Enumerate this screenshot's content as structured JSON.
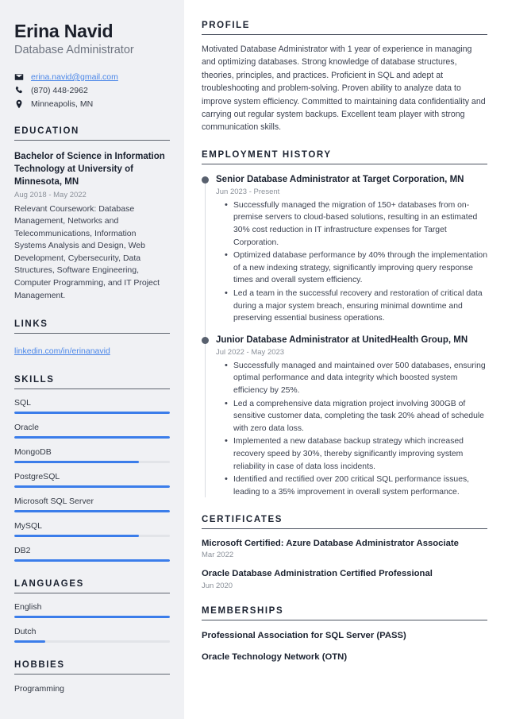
{
  "header": {
    "name": "Erina Navid",
    "job_title": "Database Administrator",
    "contacts": [
      {
        "icon": "envelope-icon",
        "value": "erina.navid@gmail.com",
        "is_link": true
      },
      {
        "icon": "phone-icon",
        "value": "(870) 448-2962",
        "is_link": false
      },
      {
        "icon": "location-pin-icon",
        "value": "Minneapolis, MN",
        "is_link": false
      }
    ]
  },
  "sidebar": {
    "education": {
      "heading": "EDUCATION",
      "degree": "Bachelor of Science in Information Technology at University of Minnesota, MN",
      "date": "Aug 2018 - May 2022",
      "description": "Relevant Coursework: Database Management, Networks and Telecommunications, Information Systems Analysis and Design, Web Development, Cybersecurity, Data Structures, Software Engineering, Computer Programming, and IT Project Management."
    },
    "links": {
      "heading": "LINKS",
      "items": [
        {
          "label": "linkedin.com/in/erinanavid"
        }
      ]
    },
    "skills": {
      "heading": "SKILLS",
      "items": [
        {
          "label": "SQL",
          "level": 100
        },
        {
          "label": "Oracle",
          "level": 100
        },
        {
          "label": "MongoDB",
          "level": 80
        },
        {
          "label": "PostgreSQL",
          "level": 100
        },
        {
          "label": "Microsoft SQL Server",
          "level": 100
        },
        {
          "label": "MySQL",
          "level": 80
        },
        {
          "label": "DB2",
          "level": 100
        }
      ]
    },
    "languages": {
      "heading": "LANGUAGES",
      "items": [
        {
          "label": "English",
          "level": 100
        },
        {
          "label": "Dutch",
          "level": 20
        }
      ]
    },
    "hobbies": {
      "heading": "HOBBIES",
      "items": [
        {
          "label": "Programming"
        }
      ]
    }
  },
  "main": {
    "profile": {
      "heading": "PROFILE",
      "text": "Motivated Database Administrator with 1 year of experience in managing and optimizing databases. Strong knowledge of database structures, theories, principles, and practices. Proficient in SQL and adept at troubleshooting and problem-solving. Proven ability to analyze data to improve system efficiency. Committed to maintaining data confidentiality and carrying out regular system backups. Excellent team player with strong communication skills."
    },
    "employment": {
      "heading": "EMPLOYMENT HISTORY",
      "jobs": [
        {
          "role": "Senior Database Administrator at Target Corporation, MN",
          "date": "Jun 2023 - Present",
          "bullets": [
            "Successfully managed the migration of 150+ databases from on-premise servers to cloud-based solutions, resulting in an estimated 30% cost reduction in IT infrastructure expenses for Target Corporation.",
            "Optimized database performance by 40% through the implementation of a new indexing strategy, significantly improving query response times and overall system efficiency.",
            "Led a team in the successful recovery and restoration of critical data during a major system breach, ensuring minimal downtime and preserving essential business operations."
          ]
        },
        {
          "role": "Junior Database Administrator at UnitedHealth Group, MN",
          "date": "Jul 2022 - May 2023",
          "bullets": [
            "Successfully managed and maintained over 500 databases, ensuring optimal performance and data integrity which boosted system efficiency by 25%.",
            "Led a comprehensive data migration project involving 300GB of sensitive customer data, completing the task 20% ahead of schedule with zero data loss.",
            "Implemented a new database backup strategy which increased recovery speed by 30%, thereby significantly improving system reliability in case of data loss incidents.",
            "Identified and rectified over 200 critical SQL performance issues, leading to a 35% improvement in overall system performance."
          ]
        }
      ]
    },
    "certificates": {
      "heading": "CERTIFICATES",
      "items": [
        {
          "name": "Microsoft Certified: Azure Database Administrator Associate",
          "date": "Mar 2022"
        },
        {
          "name": "Oracle Database Administration Certified Professional",
          "date": "Jun 2020"
        }
      ]
    },
    "memberships": {
      "heading": "MEMBERSHIPS",
      "items": [
        {
          "name": "Professional Association for SQL Server (PASS)"
        },
        {
          "name": "Oracle Technology Network (OTN)"
        }
      ]
    }
  },
  "colors": {
    "accent_blue": "#3b7dea",
    "link_blue": "#4a86e8",
    "sidebar_bg": "#f0f1f4",
    "heading_dark": "#1b2230",
    "muted_gray": "#8a9099"
  }
}
